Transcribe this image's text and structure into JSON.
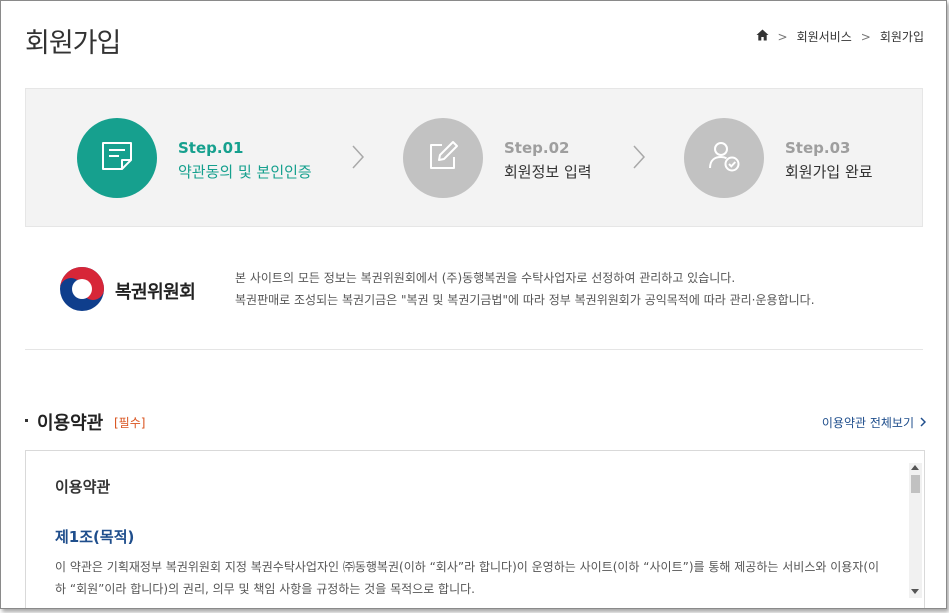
{
  "header": {
    "title": "회원가입"
  },
  "breadcrumb": {
    "items": [
      "회원서비스",
      "회원가입"
    ]
  },
  "steps": [
    {
      "num": "Step.01",
      "label": "약관동의 및 본인인증",
      "icon": "document-icon",
      "state": "active"
    },
    {
      "num": "Step.02",
      "label": "회원정보 입력",
      "icon": "edit-icon",
      "state": "inactive"
    },
    {
      "num": "Step.03",
      "label": "회원가입 완료",
      "icon": "user-check-icon",
      "state": "inactive"
    }
  ],
  "org": {
    "name": "복권위원회",
    "desc_line1": "본 사이트의 모든 정보는 복권위원회에서 (주)동행복권을 수탁사업자로 선정하여 관리하고 있습니다.",
    "desc_line2": "복권판매로 조성되는 복권기금은 \"복권 및 복권기금법\"에 따라 정부 복권위원회가 공익목적에 따라 관리·운용합니다."
  },
  "terms": {
    "section_title": "이용약관",
    "required": "[필수]",
    "view_all": "이용약관 전체보기",
    "heading": "이용약관",
    "article_title": "제1조(목적)",
    "body": "이 약관은 기획재정부 복권위원회 지정 복권수탁사업자인 ㈜동행복권(이하 “회사”라 합니다)이 운영하는 사이트(이하 “사이트”)를 통해 제공하는 서비스와 이용자(이하 “회원”이라 합니다)의 권리, 의무 및 책임 사항을 규정하는 것을 목적으로 합니다."
  },
  "colors": {
    "accent": "#16a08e",
    "inactive": "#c2c2c2",
    "link": "#1f4e8c",
    "required": "#d9531e"
  }
}
